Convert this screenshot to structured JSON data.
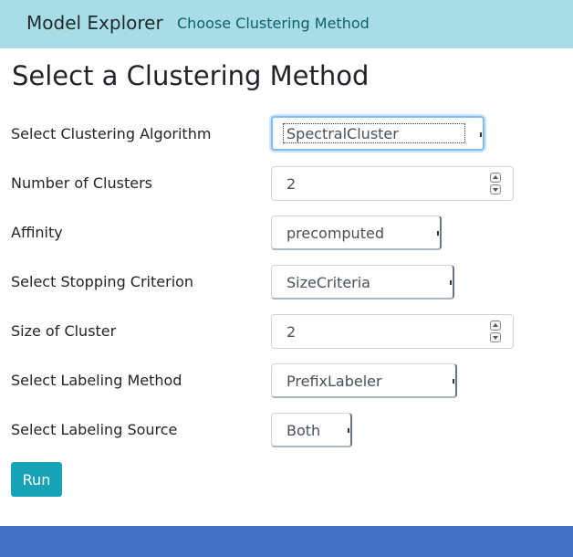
{
  "navbar": {
    "brand": "Model Explorer",
    "link": "Choose Clustering Method"
  },
  "page": {
    "title": "Select a Clustering Method"
  },
  "form": {
    "algorithm": {
      "label": "Select Clustering Algorithm",
      "value": "SpectralCluster"
    },
    "num_clusters": {
      "label": "Number of Clusters",
      "value": "2"
    },
    "affinity": {
      "label": "Affinity",
      "value": "precomputed"
    },
    "stopping": {
      "label": "Select Stopping Criterion",
      "value": "SizeCriteria"
    },
    "cluster_size": {
      "label": "Size of Cluster",
      "value": "2"
    },
    "labeling_method": {
      "label": "Select Labeling Method",
      "value": "PrefixLabeler"
    },
    "labeling_source": {
      "label": "Select Labeling Source",
      "value": "Both"
    },
    "run_label": "Run"
  },
  "colors": {
    "navbar_bg": "#a8dde6",
    "run_button": "#17a2b8",
    "footer_bg": "#4472c4"
  },
  "icons": {
    "spinner": "up-down-stepper-icon",
    "select_arrow": "dropdown-arrow-icon"
  }
}
